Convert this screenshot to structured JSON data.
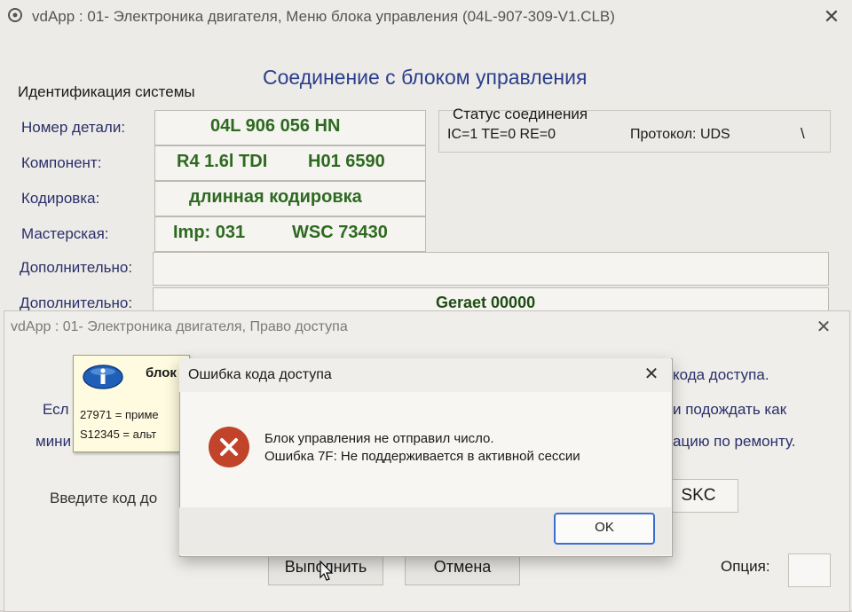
{
  "main_window": {
    "title": "vdApp : 01- Электроника двигателя,  Меню блока управления (04L-907-309-V1.CLB)",
    "close_glyph": "✕",
    "connection_header": "Соединение с блоком управления",
    "system_id_label": "Идентификация системы",
    "rows": {
      "part_number": {
        "label": "Номер детали:",
        "value": "04L  906 056 HN"
      },
      "component": {
        "label": "Компонент:",
        "value_a": "R4 1.6l TDI",
        "value_b": "H01 6590"
      },
      "coding": {
        "label": "Кодировка:",
        "value": "длинная кодировка"
      },
      "workshop": {
        "label": "Мастерская:",
        "value_a": "Imp: 031",
        "value_b": "WSC 73430"
      },
      "extra1": {
        "label": "Дополнительно:",
        "value": ""
      },
      "extra2": {
        "label": "Дополнительно:",
        "value": "Geraet 00000"
      }
    },
    "status": {
      "title": "Статус соединения",
      "line": "IC=1  TE=0   RE=0",
      "protocol": "Протокол: UDS",
      "spinner": "\\"
    }
  },
  "access_window": {
    "title": "vdApp : 01- Электроника двигателя,  Право доступа",
    "close_glyph": "✕",
    "text_right1": "кода доступа.",
    "text_left2": "Есл",
    "text_right2": "и подождать как",
    "text_left3": "мини",
    "text_right3": "ацию по ремонту.",
    "enter_code_label": "Введите код до",
    "tooltip": {
      "bold": "блок",
      "line1": "27971 = приме",
      "line2": "S12345 = альт"
    },
    "skc_button": "SKC",
    "execute_button": "Выполнить",
    "cancel_button": "Отмена",
    "option_label": "Опция:"
  },
  "error_dialog": {
    "title": "Ошибка кода доступа",
    "close_glyph": "✕",
    "message_line1": "Блок управления не отправил число.",
    "message_line2": "Ошибка 7F: Не поддерживается в активной сессии",
    "ok_button": "OK"
  },
  "colors": {
    "accent_blue": "#2a3e8c",
    "value_green": "#2d6a1f",
    "error_red": "#c0432a",
    "ok_border": "#3c6fd1"
  }
}
